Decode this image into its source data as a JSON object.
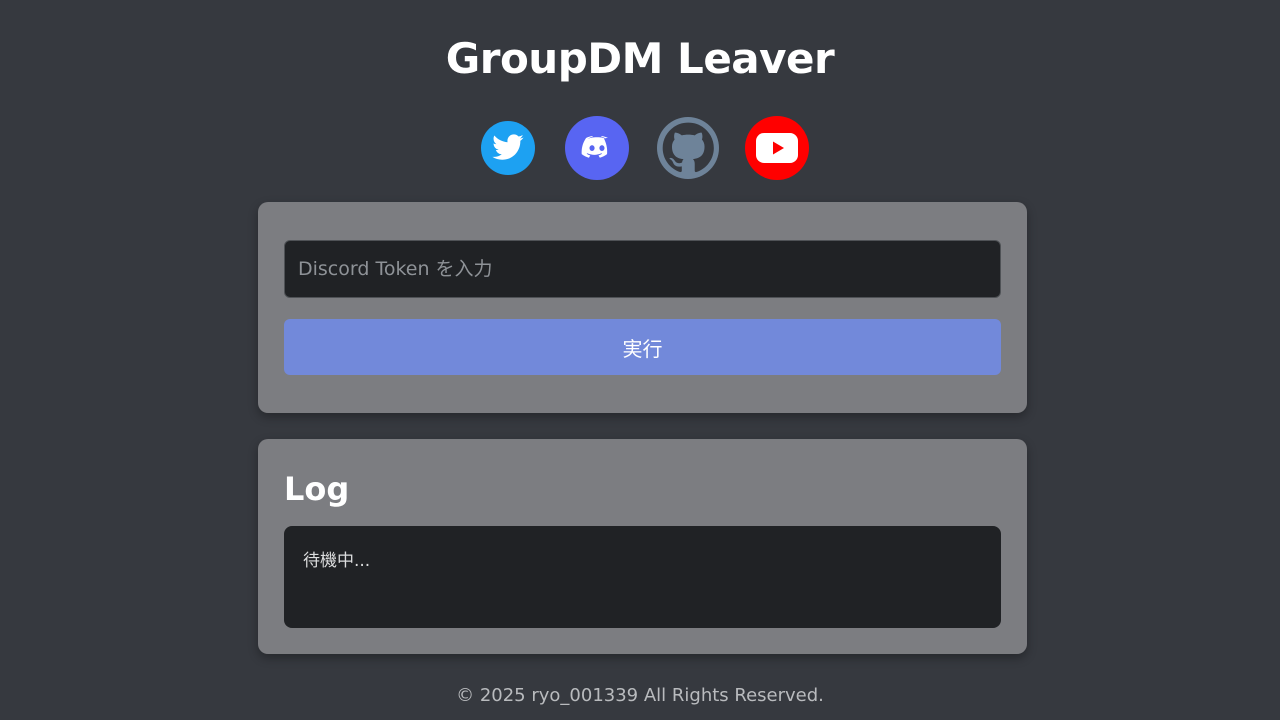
{
  "header": {
    "title": "GroupDM Leaver"
  },
  "social": [
    {
      "name": "twitter-icon",
      "color": "#1da1f2"
    },
    {
      "name": "discord-icon",
      "color": "#5865f2"
    },
    {
      "name": "github-icon",
      "color": "#6e8399"
    },
    {
      "name": "youtube-icon",
      "color": "#ff0000"
    }
  ],
  "form": {
    "token_placeholder": "Discord Token を入力",
    "token_value": "",
    "run_label": "実行"
  },
  "log": {
    "heading": "Log",
    "status": "待機中..."
  },
  "footer": {
    "copyright": "© 2025 ryo_001339 All Rights Reserved."
  },
  "colors": {
    "background": "#36393f",
    "card": "#7c7d81",
    "input_bg": "#202225",
    "accent": "#7289da"
  }
}
